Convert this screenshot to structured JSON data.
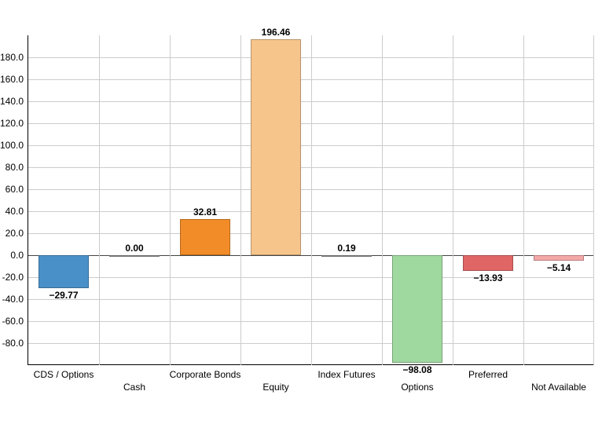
{
  "chart_data": {
    "type": "bar",
    "categories": [
      "CDS / Options",
      "Cash",
      "Corporate Bonds",
      "Equity",
      "Index Futures",
      "Options",
      "Preferred",
      "Not Available"
    ],
    "values": [
      -29.77,
      0.0,
      32.81,
      196.46,
      0.19,
      -98.08,
      -13.93,
      -5.14
    ],
    "value_labels": [
      "−29.77",
      "0.00",
      "32.81",
      "196.46",
      "0.19",
      "−98.08",
      "−13.93",
      "−5.14"
    ],
    "colors": [
      "#4a90c8",
      "#999999",
      "#f28c28",
      "#f6c58b",
      "#999999",
      "#9fd99f",
      "#e06666",
      "#f4a8a8"
    ],
    "title": "",
    "xlabel": "",
    "ylabel": "",
    "ylim": [
      -100,
      200
    ],
    "y_ticks": [
      -80,
      -60,
      -40,
      -20,
      0,
      20,
      40,
      60,
      80,
      100,
      120,
      140,
      160,
      180
    ],
    "y_tick_labels": [
      "-80.0",
      "-60.0",
      "-40.0",
      "-20.0",
      "0.0",
      "20.0",
      "40.0",
      "60.0",
      "80.0",
      "100.0",
      "120.0",
      "140.0",
      "160.0",
      "180.0"
    ]
  }
}
